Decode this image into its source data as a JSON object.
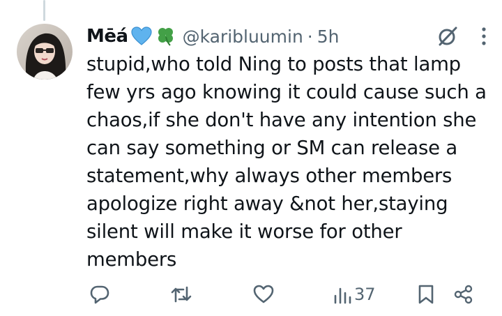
{
  "tweet": {
    "display_name": "Mēá",
    "emojis": [
      "blue-heart",
      "four-leaf-clover"
    ],
    "handle": "@karibluumin",
    "separator": "·",
    "time": "5h",
    "text": "stupid,who told Ning to posts that lamp few yrs ago knowing it could cause such a chaos,if she don't have any intention she can say something or SM can release a statement,why always other members apologize right away &not her,staying silent will make it worse for other members"
  },
  "actions": {
    "views": "37",
    "icons": [
      "reply-icon",
      "retweet-icon",
      "like-icon",
      "views-icon",
      "bookmark-icon",
      "share-icon"
    ]
  },
  "colors": {
    "text": "#0f1419",
    "secondary": "#536471",
    "thread_line": "#cfd9de"
  }
}
